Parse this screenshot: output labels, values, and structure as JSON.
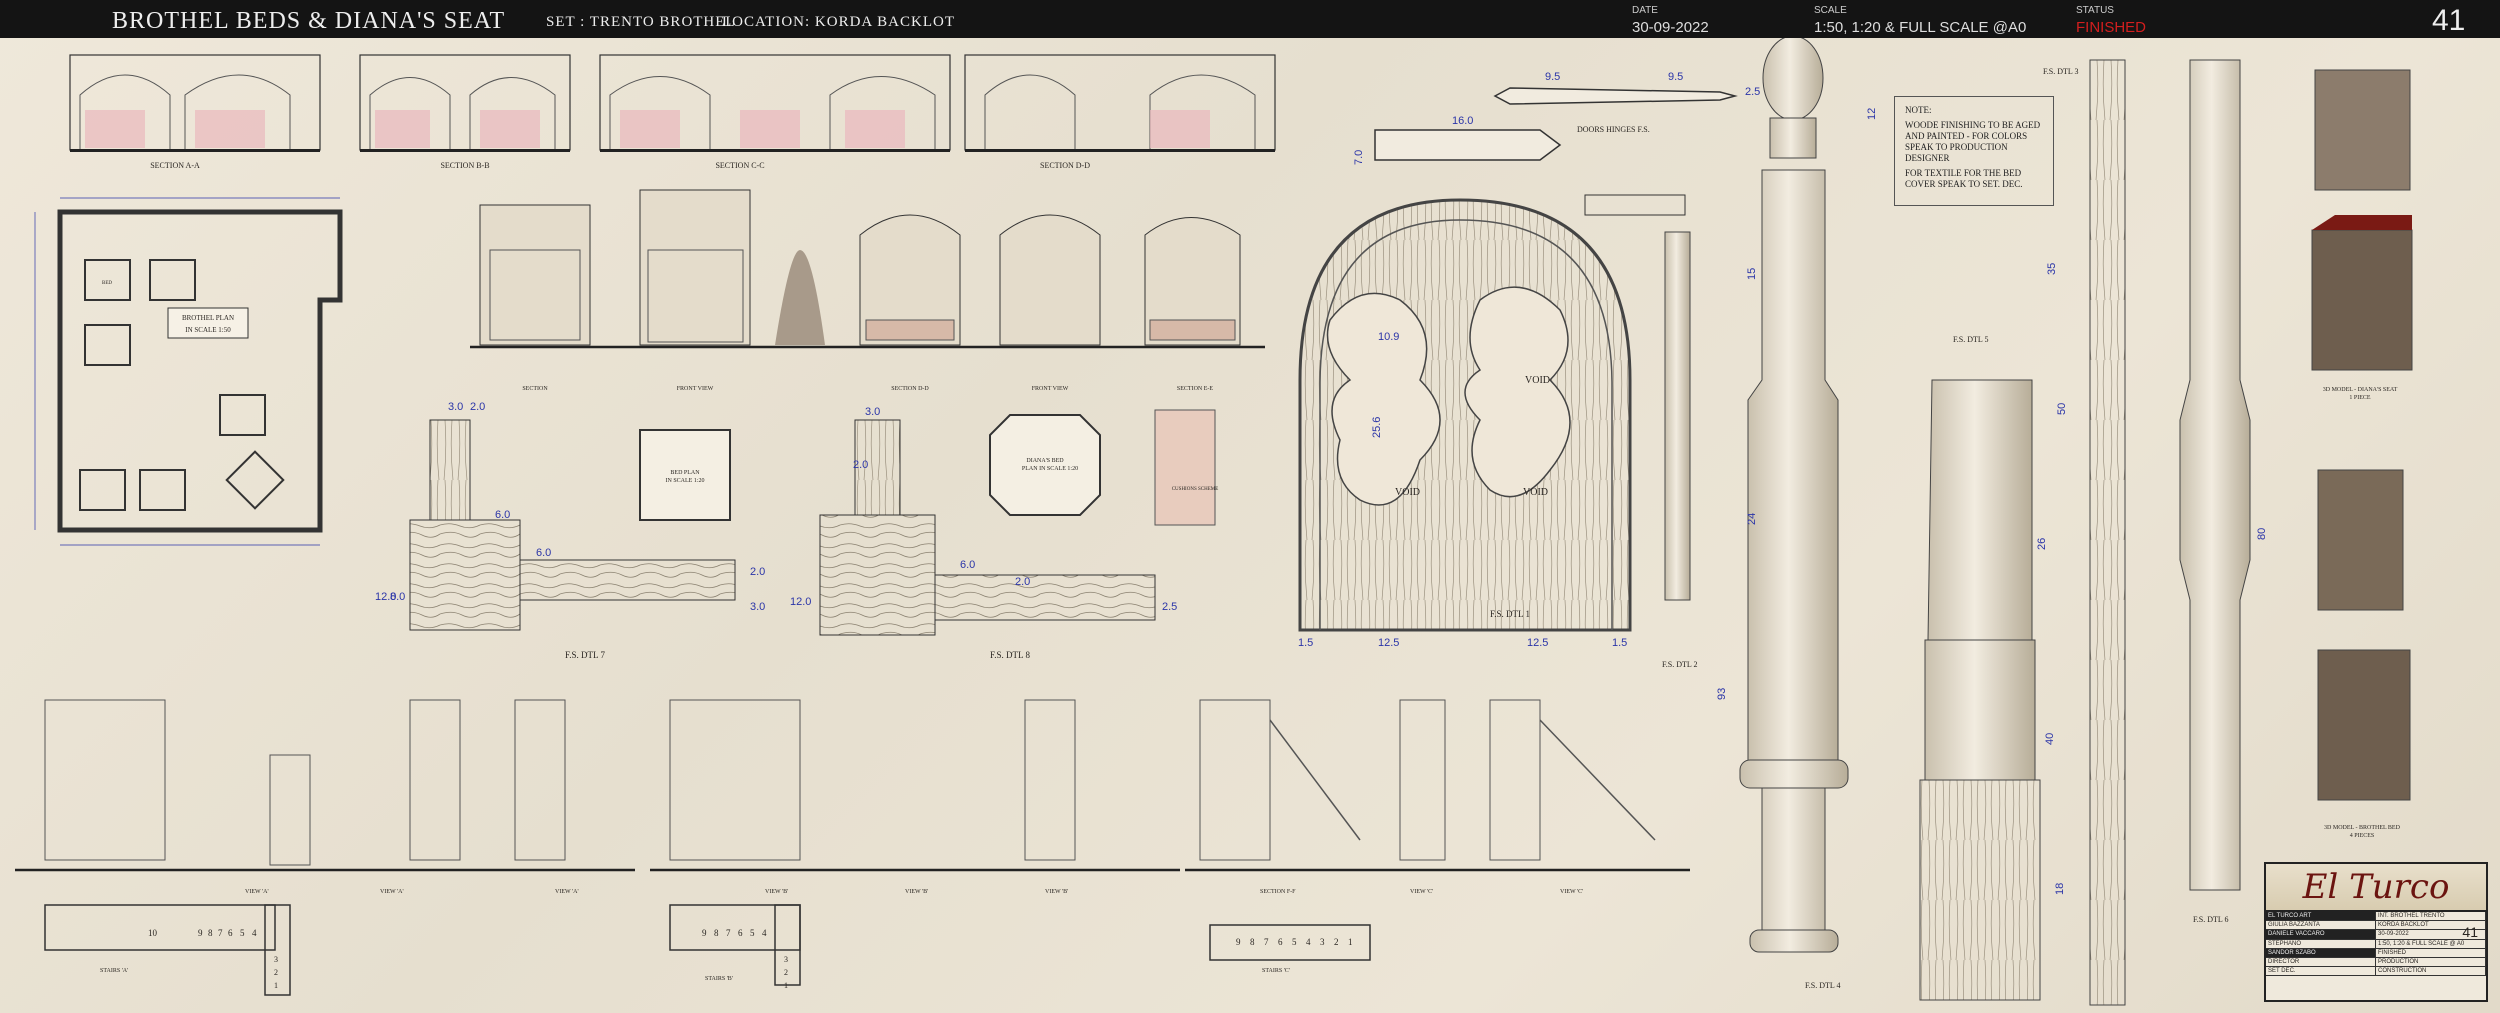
{
  "header": {
    "title": "BROTHEL  BEDS  &  DIANA'S SEAT",
    "set": "SET :  TRENTO  BROTHEL",
    "location": "LOCATION:  KORDA BACKLOT",
    "date_label": "DATE",
    "date_value": "30-09-2022",
    "scale_label": "SCALE",
    "scale_value": "1:50, 1:20 & FULL SCALE  @A0",
    "status_label": "STATUS",
    "status_value": "FINISHED",
    "sheet_number": "41"
  },
  "sections": [
    "SECTION  A-A",
    "SECTION  B-B",
    "SECTION  C-C",
    "SECTION  D-D"
  ],
  "elevation_labels": [
    "SECTION",
    "FRONT VIEW",
    "SECTION D-D",
    "FRONT VIEW",
    "SECTION E-E"
  ],
  "plan": {
    "title": "BROTHEL PLAN",
    "scale": "IN SCALE 1:50",
    "room_label": "BED"
  },
  "bed_plans": {
    "bed_plan_title": "BED PLAN",
    "bed_plan_scale": "IN SCALE 1:20",
    "diana_title": "DIANA'S BED",
    "diana_scale": "PLAN IN SCALE 1:20",
    "cushions": "CUSHIONS SCHEME"
  },
  "details": {
    "dtl7": "F.S.  DTL 7",
    "dtl8": "F.S.  DTL 8",
    "dtl1": "F.S. DTL 1",
    "dtl2": "F.S. DTL 2",
    "dtl3": "F.S. DTL 3",
    "dtl4": "F.S. DTL 4",
    "dtl5": "F.S. DTL 5",
    "dtl6": "F.S. DTL 6",
    "hinges": "DOORS HINGES F.S.",
    "void": "VOID"
  },
  "dimensions": {
    "d30": "3.0",
    "d20": "2.0",
    "d60": "6.0",
    "d120": "12.0",
    "d80": "8.0",
    "d25": "2.5",
    "d95": "9.5",
    "d160": "16.0",
    "d70": "7.0",
    "d109": "10.9",
    "d256": "25.6",
    "d15": "1.5",
    "d125": "12.5",
    "d12": "12",
    "d15b": "15",
    "d24": "24",
    "d93": "93",
    "d35": "35",
    "d50": "50",
    "d26": "26",
    "d40": "40",
    "d18": "18",
    "d80b": "80"
  },
  "notes": {
    "heading": "NOTE:",
    "line1": "WOODE FINISHING TO BE AGED AND PAINTED - FOR COLORS SPEAK TO PRODUCTION DESIGNER",
    "line2": "FOR TEXTILE FOR THE BED COVER SPEAK TO SET. DEC."
  },
  "models": {
    "diana": "3D MODEL - DIANA'S SEAT",
    "diana_pieces": "1 PIECE",
    "bed": "3D MODEL - BROTHEL BED",
    "bed_pieces": "4 PIECES"
  },
  "stairs": {
    "stairs_a": "STAIRS 'A'",
    "stairs_b": "STAIRS 'B'",
    "stairs_c": "STAIRS 'C'",
    "steps_a": [
      "10",
      "9",
      "8",
      "7",
      "6",
      "5",
      "4"
    ],
    "steps_b": [
      "9",
      "8",
      "7",
      "6",
      "5",
      "4"
    ],
    "steps_c": [
      "9",
      "8",
      "7",
      "6",
      "5",
      "4",
      "3",
      "2",
      "1"
    ],
    "side_steps": [
      "3",
      "2",
      "1"
    ],
    "views": [
      "VIEW 'A'",
      "VIEW 'A'",
      "VIEW 'A'",
      "VIEW 'B'",
      "VIEW 'B'",
      "VIEW 'B'",
      "SECTION F-F",
      "VIEW 'C'",
      "VIEW 'C'"
    ]
  },
  "title_block": {
    "logo": "El Turco",
    "rows": [
      [
        "EL TURCO ART",
        "INT. BROTHEL TRENTO"
      ],
      [
        "GIULIA BAZZANTA",
        "KORDA BACKLOT"
      ],
      [
        "DANIELE VACCARO",
        "30-09-2022"
      ],
      [
        "STEPHANO",
        "1:50, 1:20 & FULL SCALE @ A0"
      ],
      [
        "SANDOR SZABO",
        "FINISHED"
      ],
      [
        "DIRECTOR",
        "PRODUCTION"
      ],
      [
        "SET DEC.",
        "CONSTRUCTION"
      ]
    ],
    "sheet_number": "41"
  }
}
